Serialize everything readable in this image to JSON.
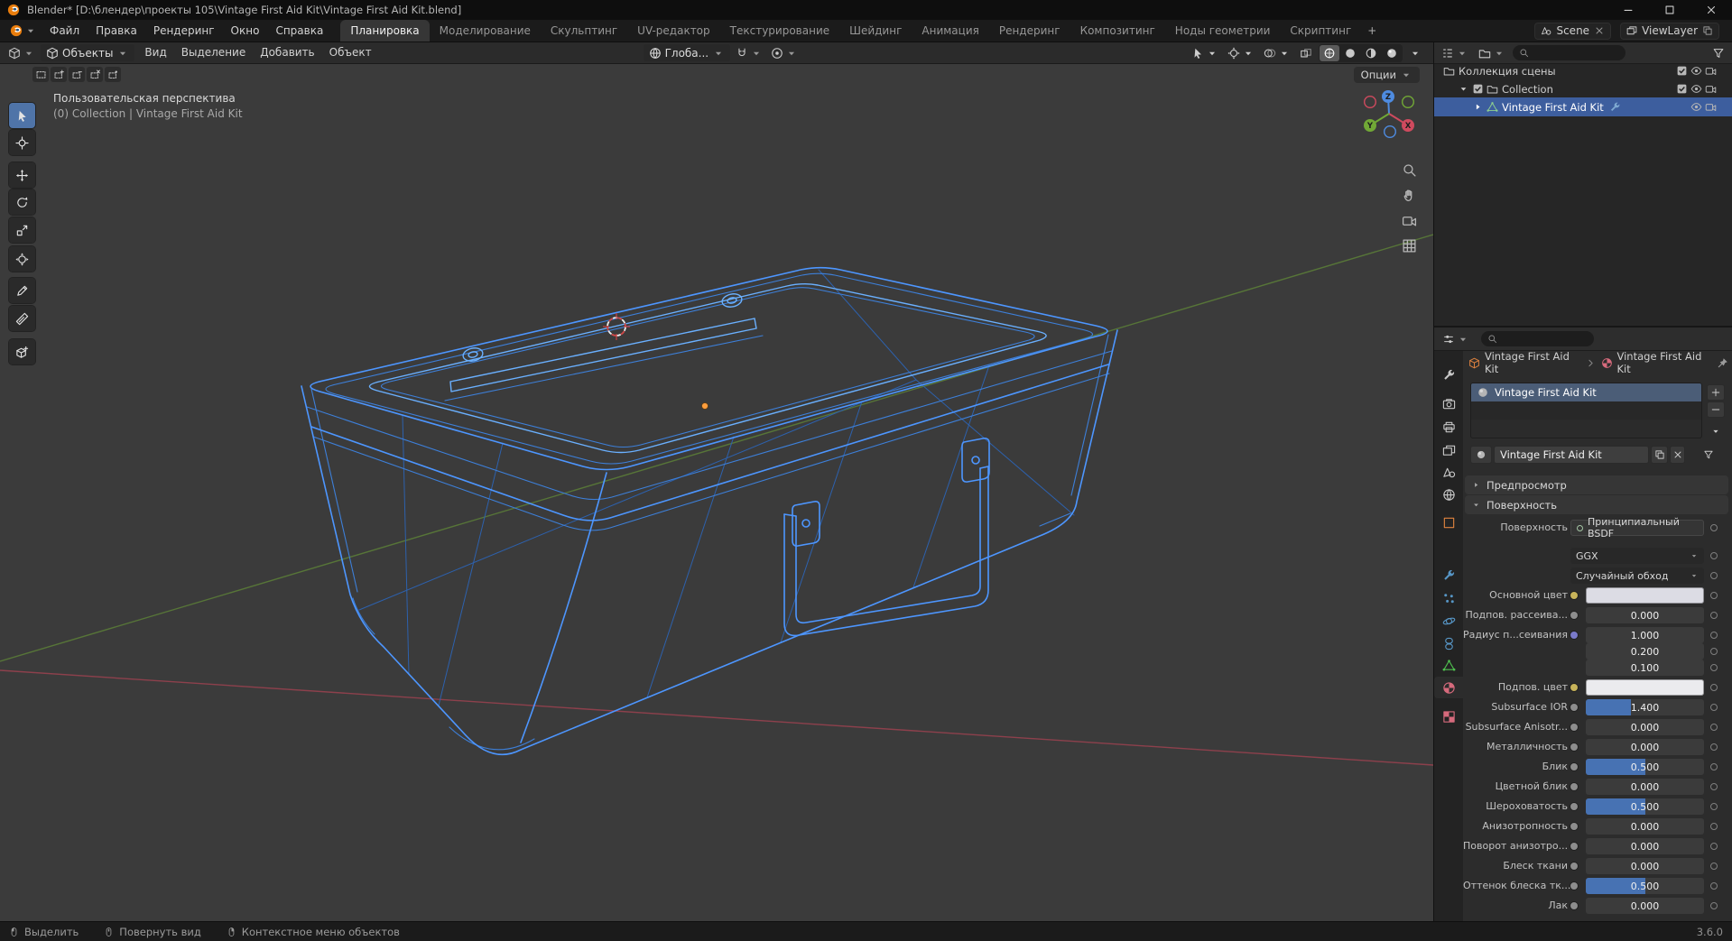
{
  "window": {
    "title": "Blender* [D:\\блендер\\проекты 105\\Vintage First Aid Kit\\Vintage First Aid Kit.blend]"
  },
  "topbar": {
    "menus": [
      "Файл",
      "Правка",
      "Рендеринг",
      "Окно",
      "Справка"
    ],
    "workspaces": [
      "Планировка",
      "Моделирование",
      "Скульптинг",
      "UV-редактор",
      "Текстурирование",
      "Шейдинг",
      "Анимация",
      "Рендеринг",
      "Композитинг",
      "Ноды геометрии",
      "Скриптинг"
    ],
    "active_workspace": "Планировка",
    "add_tab": "+",
    "scene_label": "Scene",
    "viewlayer_label": "ViewLayer"
  },
  "viewport": {
    "mode": "Объекты",
    "menus": [
      "Вид",
      "Выделение",
      "Добавить",
      "Объект"
    ],
    "orientation": "Глоба...",
    "options_label": "Опции",
    "overlay_line1": "Пользовательская перспектива",
    "overlay_line2": "(0) Collection | Vintage First Aid Kit",
    "gizmo": {
      "x": "X",
      "y": "Y",
      "z": "Z"
    },
    "tools": [
      "select-box",
      "cursor",
      "move",
      "rotate",
      "scale",
      "transform",
      "annotate",
      "measure",
      "add-cube"
    ],
    "active_tool": "select-box",
    "select_mode_icons": [
      "select-new",
      "select-extend",
      "select-subtract",
      "select-invert",
      "select-intersect"
    ],
    "nav_icons": [
      "zoom",
      "hand",
      "camera",
      "grid"
    ],
    "shading_modes": [
      "wireframe",
      "solid",
      "material-preview",
      "rendered"
    ],
    "active_shading": "wireframe",
    "header_toggle_icons": [
      "pointer",
      "transform",
      "overlays",
      "xray"
    ]
  },
  "outliner": {
    "rows": [
      {
        "label": "Коллекция сцены",
        "icon": "collection",
        "indent": 0,
        "right": [
          "checkbox",
          "eye",
          "camera-front"
        ]
      },
      {
        "label": "Collection",
        "icon": "collection",
        "indent": 1,
        "disclosure": "down",
        "checkbox": true,
        "right": [
          "checkbox",
          "eye",
          "camera-front"
        ]
      },
      {
        "label": "Vintage First Aid Kit",
        "icon": "mesh-data",
        "indent": 2,
        "disclosure": "right",
        "selected": true,
        "badge": "wrench",
        "right": [
          "eye",
          "camera-front"
        ]
      }
    ]
  },
  "properties": {
    "breadcrumb": {
      "object": "Vintage First Aid Kit",
      "material": "Vintage First Aid Kit"
    },
    "slots": [
      {
        "name": "Vintage First Aid Kit"
      }
    ],
    "name_field": "Vintage First Aid Kit",
    "panels": {
      "preview": "Предпросмотр",
      "surface": "Поверхность"
    },
    "tabs": [
      {
        "name": "tool",
        "icon": "wrench",
        "color": "#c8c8c8"
      },
      {
        "name": "render",
        "icon": "camera-back",
        "color": "#c8c8c8"
      },
      {
        "name": "output",
        "icon": "printer",
        "color": "#c8c8c8"
      },
      {
        "name": "view-layer",
        "icon": "images",
        "color": "#c8c8c8"
      },
      {
        "name": "scene",
        "icon": "scene",
        "color": "#c8c8c8"
      },
      {
        "name": "world",
        "icon": "world",
        "color": "#c8c8c8"
      },
      {
        "name": "object",
        "icon": "square",
        "color": "#e0833f"
      },
      {
        "name": "modifiers",
        "icon": "wrench",
        "color": "#5796c6"
      },
      {
        "name": "particles",
        "icon": "particles",
        "color": "#5796c6"
      },
      {
        "name": "physics",
        "icon": "physics",
        "color": "#5796c6"
      },
      {
        "name": "constraints",
        "icon": "constraint",
        "color": "#5796c6"
      },
      {
        "name": "data",
        "icon": "mesh-data",
        "color": "#4fbf4f"
      },
      {
        "name": "material",
        "icon": "material-sphere",
        "color": "#d66a7c",
        "active": true
      },
      {
        "name": "texture",
        "icon": "texture-checker",
        "color": "#d66a7c"
      }
    ],
    "surface_rows": [
      {
        "label": "Поверхность",
        "kind": "shader",
        "value": "Принципиальный BSDF"
      },
      {
        "label": "",
        "kind": "enum",
        "value": "GGX",
        "gap_before": 9
      },
      {
        "label": "",
        "kind": "enum",
        "value": "Случайный обход"
      },
      {
        "label": "Основной цвет",
        "kind": "color",
        "color": "#dcdce4",
        "socket": "#c7b35a"
      },
      {
        "label": "Подпов. рассеива...",
        "kind": "value",
        "value": "0.000",
        "fill": 0,
        "socket": "#8d8d8d"
      },
      {
        "label": "Радиус п...сеивания",
        "kind": "value",
        "value": "1.000",
        "fill": 0,
        "socket": "#7a7ac9",
        "compact": true
      },
      {
        "label": "",
        "kind": "value",
        "value": "0.200",
        "fill": 0,
        "compact": true
      },
      {
        "label": "",
        "kind": "value",
        "value": "0.100",
        "fill": 0
      },
      {
        "label": "Подпов. цвет",
        "kind": "color",
        "color": "#ebebee",
        "socket": "#c7b35a"
      },
      {
        "label": "Subsurface IOR",
        "kind": "value",
        "value": "1.400",
        "fill": 0.38,
        "socket": "#8d8d8d"
      },
      {
        "label": "Subsurface Anisotr...",
        "kind": "value",
        "value": "0.000",
        "fill": 0,
        "socket": "#8d8d8d"
      },
      {
        "label": "Металличность",
        "kind": "value",
        "value": "0.000",
        "fill": 0,
        "socket": "#8d8d8d"
      },
      {
        "label": "Блик",
        "kind": "value",
        "value": "0.500",
        "fill": 0.5,
        "socket": "#8d8d8d"
      },
      {
        "label": "Цветной блик",
        "kind": "value",
        "value": "0.000",
        "fill": 0,
        "socket": "#8d8d8d"
      },
      {
        "label": "Шероховатость",
        "kind": "value",
        "value": "0.500",
        "fill": 0.5,
        "socket": "#8d8d8d"
      },
      {
        "label": "Анизотропность",
        "kind": "value",
        "value": "0.000",
        "fill": 0,
        "socket": "#8d8d8d"
      },
      {
        "label": "Поворот анизотро...",
        "kind": "value",
        "value": "0.000",
        "fill": 0,
        "socket": "#8d8d8d"
      },
      {
        "label": "Блеск ткани",
        "kind": "value",
        "value": "0.000",
        "fill": 0,
        "socket": "#8d8d8d"
      },
      {
        "label": "Оттенок блеска тк...",
        "kind": "value",
        "value": "0.500",
        "fill": 0.5,
        "socket": "#8d8d8d"
      },
      {
        "label": "Лак",
        "kind": "value",
        "value": "0.000",
        "fill": 0,
        "socket": "#8d8d8d"
      }
    ]
  },
  "statusbar": {
    "hints": [
      {
        "icon": "mouse-left",
        "label": "Выделить"
      },
      {
        "icon": "mouse-middle",
        "label": "Повернуть вид"
      },
      {
        "icon": "mouse-right",
        "label": "Контекстное меню объектов"
      }
    ],
    "version": "3.6.0"
  },
  "colors": {
    "accent": "#4772b3",
    "wire_selected": "#4d96ff",
    "axis_x": "#9c4250",
    "axis_y": "#5c8038",
    "selected_row": "#3d5e9e"
  }
}
